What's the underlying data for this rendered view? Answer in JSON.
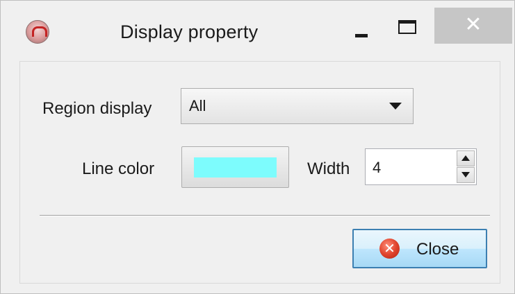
{
  "window": {
    "title": "Display property",
    "icon": "app-icon",
    "controls": {
      "minimize_icon": "minimize-icon",
      "maximize_icon": "maximize-icon",
      "close_glyph": "✕"
    }
  },
  "form": {
    "region_display": {
      "label": "Region display",
      "value": "All",
      "icon": "chevron-down-icon"
    },
    "line_color": {
      "label": "Line color",
      "color": "#7dfcfd"
    },
    "width": {
      "label": "Width",
      "value": "4"
    }
  },
  "actions": {
    "close": {
      "label": "Close",
      "icon": "close-icon",
      "glyph": "✕"
    }
  },
  "colors": {
    "window_background": "#f0f0f0",
    "titlebar_close": "#c6c6c6",
    "focus_border": "#3c7fb1"
  }
}
